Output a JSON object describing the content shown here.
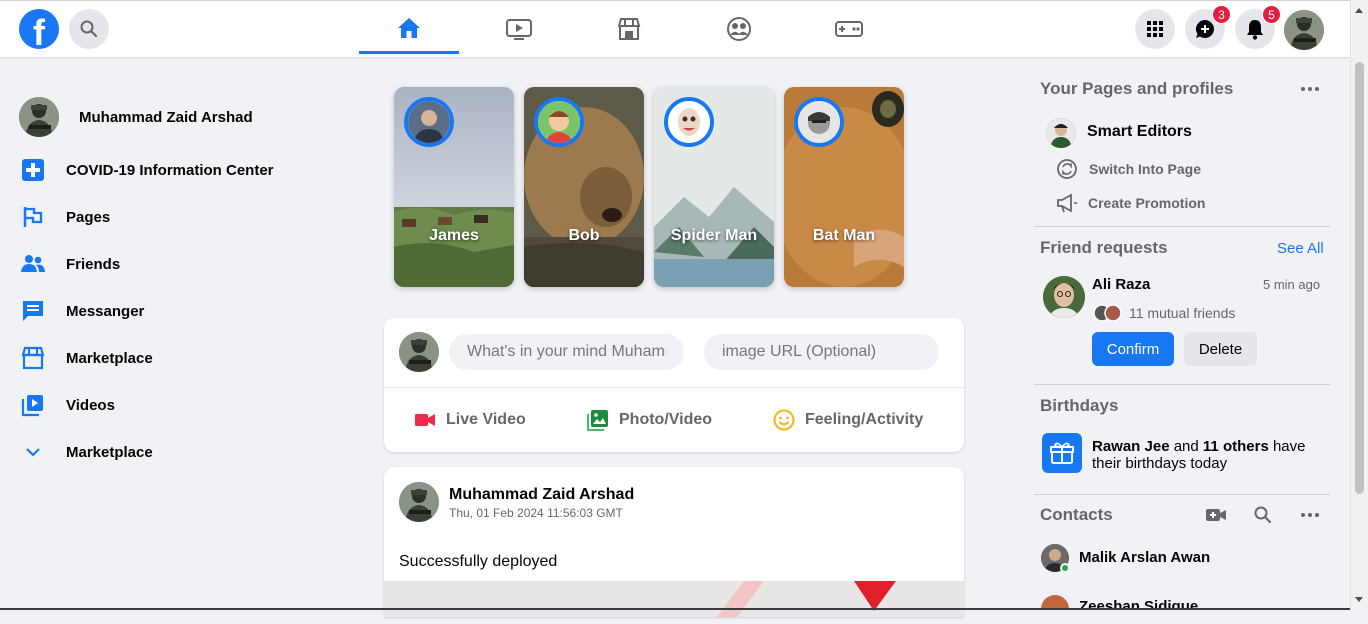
{
  "topbar": {
    "logo_letter": "f",
    "nav_tabs": [
      "home",
      "watch",
      "marketplace",
      "groups",
      "gaming"
    ],
    "messenger_badge": "3",
    "notifications_badge": "5"
  },
  "left_sidebar": {
    "profile_name": "Muhammad Zaid Arshad",
    "items": [
      {
        "label": "COVID-19 Information Center",
        "icon": "plus-square-icon"
      },
      {
        "label": "Pages",
        "icon": "flag-icon"
      },
      {
        "label": "Friends",
        "icon": "friends-icon"
      },
      {
        "label": "Messanger",
        "icon": "message-icon"
      },
      {
        "label": "Marketplace",
        "icon": "store-icon"
      },
      {
        "label": "Videos",
        "icon": "video-library-icon"
      },
      {
        "label": "Marketplace",
        "icon": "chevron-down-icon"
      }
    ]
  },
  "stories": [
    {
      "name": "James"
    },
    {
      "name": "Bob"
    },
    {
      "name": "Spider Man"
    },
    {
      "name": "Bat Man"
    }
  ],
  "composer": {
    "text_placeholder": "What's in your mind Muhammad Zaid Arshad?",
    "url_placeholder": "image URL (Optional)",
    "actions": {
      "live": "Live Video",
      "photo": "Photo/Video",
      "feeling": "Feeling/Activity"
    }
  },
  "post": {
    "author": "Muhammad Zaid Arshad",
    "timestamp": "Thu, 01 Feb 2024 11:56:03 GMT",
    "text": "Successfully deployed"
  },
  "right_sidebar": {
    "pages_heading": "Your Pages and profiles",
    "page_name": "Smart Editors",
    "switch_label": "Switch Into Page",
    "promo_label": "Create Promotion",
    "friend_requests_heading": "Friend requests",
    "see_all": "See All",
    "request": {
      "name": "Ali Raza",
      "time": "5 min ago",
      "mutual": "11 mutual friends",
      "confirm": "Confirm",
      "delete": "Delete"
    },
    "birthdays_heading": "Birthdays",
    "birthday": {
      "name": "Rawan Jee",
      "and": "and",
      "others": "11 others",
      "rest1": "have",
      "rest2": "their birthdays today"
    },
    "contacts_heading": "Contacts",
    "contacts": [
      "Malik Arslan Awan",
      "Zeeshan Sidique"
    ]
  },
  "colors": {
    "brand": "#1877f2",
    "background": "#f0f2f5",
    "badge": "#e41e3f",
    "online": "#31a24c"
  }
}
